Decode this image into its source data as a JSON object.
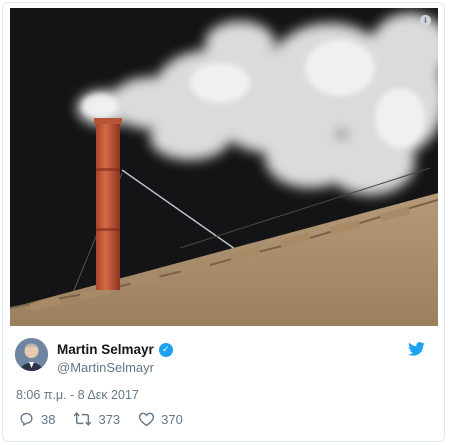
{
  "tweet": {
    "author": {
      "name": "Martin Selmayr",
      "handle": "@MartinSelmayr",
      "verified": true,
      "avatar_icon": "profile-photo"
    },
    "timestamp": "8:06 π.μ. - 8 Δεκ 2017",
    "media": {
      "info_icon_label": "i",
      "content": "photo"
    },
    "stats": {
      "replies": "38",
      "retweets": "373",
      "likes": "370"
    },
    "icons": {
      "reply": "reply-icon",
      "retweet": "retweet-icon",
      "like": "heart-icon",
      "brand": "twitter-bird-icon",
      "verified": "verified-badge-icon"
    },
    "colors": {
      "brand_blue": "#1da1f2",
      "secondary_text": "#657786",
      "primary_text": "#14171a"
    }
  }
}
